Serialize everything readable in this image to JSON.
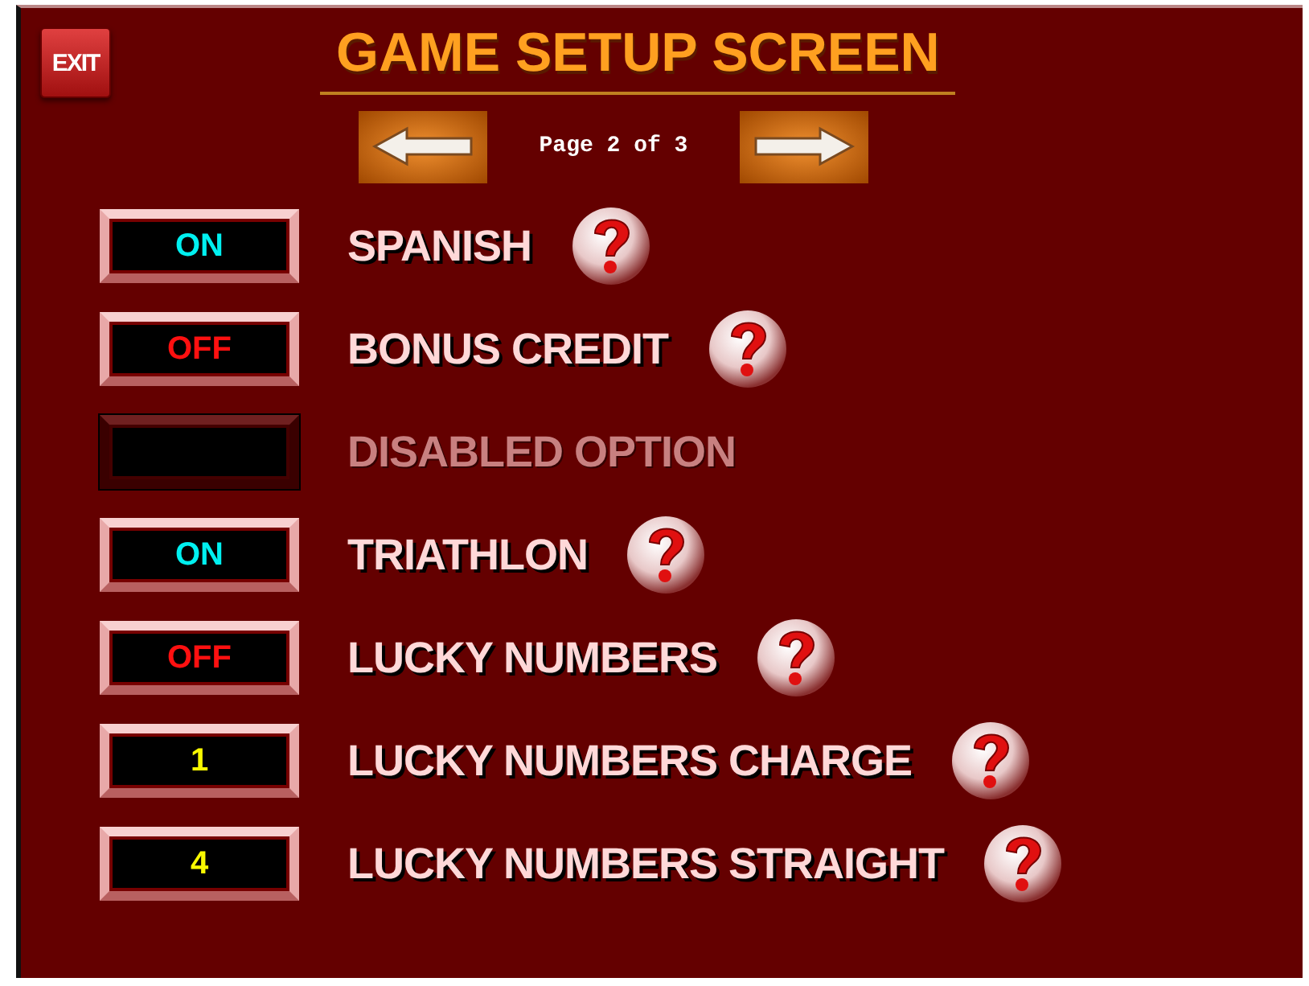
{
  "exit_button": {
    "label": "EXIT"
  },
  "title": "GAME SETUP SCREEN",
  "pager": {
    "text": "Page 2 of 3"
  },
  "options": [
    {
      "kind": "toggle",
      "on": true,
      "value": "ON",
      "label": "SPANISH"
    },
    {
      "kind": "toggle",
      "on": false,
      "value": "OFF",
      "label": "BONUS CREDIT"
    },
    {
      "kind": "disabled",
      "label": "DISABLED OPTION"
    },
    {
      "kind": "toggle",
      "on": true,
      "value": "ON",
      "label": "TRIATHLON"
    },
    {
      "kind": "toggle",
      "on": false,
      "value": "OFF",
      "label": "LUCKY NUMBERS"
    },
    {
      "kind": "number",
      "value": "1",
      "label": "LUCKY NUMBERS CHARGE"
    },
    {
      "kind": "number",
      "value": "4",
      "label": "LUCKY NUMBERS STRAIGHT"
    }
  ]
}
